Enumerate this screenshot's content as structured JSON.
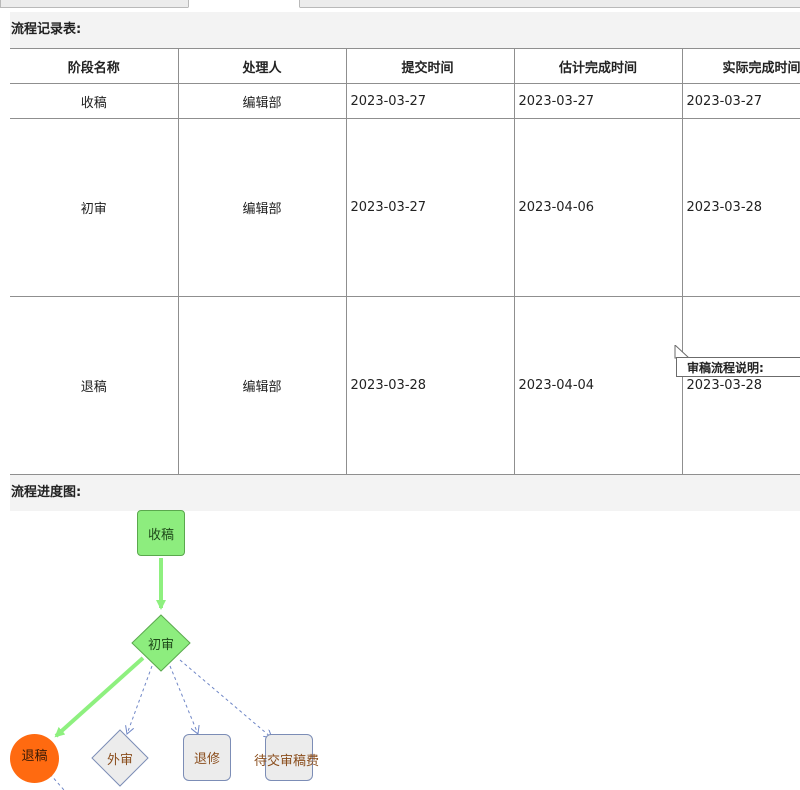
{
  "record_section": {
    "title": "流程记录表:"
  },
  "table": {
    "headers": [
      "阶段名称",
      "处理人",
      "提交时间",
      "估计完成时间",
      "实际完成时间"
    ],
    "rows": [
      [
        "收稿",
        "编辑部",
        "2023-03-27",
        "2023-03-27",
        "2023-03-27"
      ],
      [
        "初审",
        "编辑部",
        "2023-03-27",
        "2023-04-06",
        "2023-03-28"
      ],
      [
        "退稿",
        "编辑部",
        "2023-03-28",
        "2023-04-04",
        "2023-03-28"
      ]
    ]
  },
  "tooltip": {
    "text": "审稿流程说明:"
  },
  "flow_section": {
    "title": "流程进度图:"
  },
  "flow": {
    "nodes": {
      "start": "收稿",
      "review": "初审",
      "reject": "退稿",
      "external": "外审",
      "revise": "退修",
      "fee": "待交审稿费"
    },
    "colors": {
      "completed": "#8ded7e",
      "current": "#ff6a10",
      "pending": "#ececec",
      "active_edge": "#8ef07f",
      "pending_edge": "#6f86c6"
    }
  }
}
